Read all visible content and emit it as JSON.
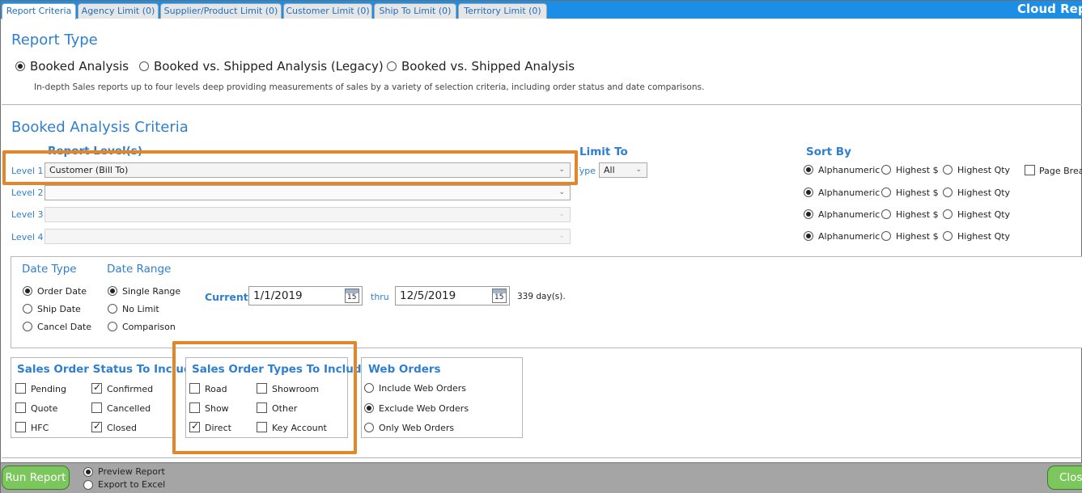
{
  "app_title": "Cloud Repo",
  "tabs": [
    {
      "label": "Report Criteria"
    },
    {
      "label": "Agency Limit (0)"
    },
    {
      "label": "Supplier/Product Limit (0)"
    },
    {
      "label": "Customer Limit (0)"
    },
    {
      "label": "Ship To Limit (0)"
    },
    {
      "label": "Territory Limit (0)"
    }
  ],
  "report_type": {
    "title": "Report Type",
    "options": [
      {
        "label": "Booked Analysis",
        "selected": true
      },
      {
        "label": "Booked vs. Shipped Analysis (Legacy)",
        "selected": false
      },
      {
        "label": "Booked vs. Shipped Analysis",
        "selected": false
      }
    ],
    "description": "In-depth Sales reports up to four levels deep providing measurements of sales by a variety of selection criteria, including order status and date comparisons."
  },
  "criteria": {
    "title": "Booked Analysis Criteria",
    "report_levels_label": "Report Level(s)",
    "levels": [
      {
        "label": "Level 1",
        "value": "Customer (Bill To)"
      },
      {
        "label": "Level 2",
        "value": ""
      },
      {
        "label": "Level 3",
        "value": ""
      },
      {
        "label": "Level 4",
        "value": ""
      }
    ],
    "limit_to": {
      "title": "Limit To",
      "type_label": "Type",
      "type_value": "All"
    },
    "sort_by": {
      "title": "Sort By",
      "option_labels": [
        "Alphanumeric",
        "Highest $",
        "Highest Qty"
      ],
      "selected": [
        "Alphanumeric",
        "Alphanumeric",
        "Alphanumeric",
        "Alphanumeric"
      ],
      "page_break_label": "Page Break"
    }
  },
  "date_type": {
    "title": "Date Type",
    "options": [
      {
        "label": "Order Date",
        "selected": true
      },
      {
        "label": "Ship Date",
        "selected": false
      },
      {
        "label": "Cancel Date",
        "selected": false
      }
    ]
  },
  "date_range": {
    "title": "Date Range",
    "options": [
      {
        "label": "Single Range",
        "selected": true
      },
      {
        "label": "No Limit",
        "selected": false
      },
      {
        "label": "Comparison",
        "selected": false
      }
    ],
    "current_label": "Current",
    "start": "1/1/2019",
    "thru_label": "thru",
    "end": "12/5/2019",
    "calendar_day": "15",
    "days_text": "339 day(s)."
  },
  "order_status": {
    "title": "Sales Order Status To Include",
    "items": [
      {
        "label": "Pending",
        "checked": false
      },
      {
        "label": "Confirmed",
        "checked": true
      },
      {
        "label": "Quote",
        "checked": false
      },
      {
        "label": "Cancelled",
        "checked": false
      },
      {
        "label": "HFC",
        "checked": false
      },
      {
        "label": "Closed",
        "checked": true
      }
    ]
  },
  "order_types": {
    "title": "Sales Order Types To Include",
    "items": [
      {
        "label": "Road",
        "checked": false
      },
      {
        "label": "Showroom",
        "checked": false
      },
      {
        "label": "Show",
        "checked": false
      },
      {
        "label": "Other",
        "checked": false
      },
      {
        "label": "Direct",
        "checked": true
      },
      {
        "label": "Key Account",
        "checked": false
      }
    ]
  },
  "web_orders": {
    "title": "Web Orders",
    "options": [
      {
        "label": "Include Web Orders",
        "selected": false
      },
      {
        "label": "Exclude Web Orders",
        "selected": true
      },
      {
        "label": "Only Web Orders",
        "selected": false
      }
    ]
  },
  "footer": {
    "run_label": "Run Report",
    "output_options": [
      {
        "label": "Preview Report",
        "selected": true
      },
      {
        "label": "Export to Excel",
        "selected": false
      }
    ],
    "close_label": "Clos"
  },
  "colors": {
    "tab_bar": "#1c8ee6",
    "heading_blue": "#2f7fd0",
    "highlight_orange": "#e2862a",
    "button_green": "#7cc65e"
  }
}
